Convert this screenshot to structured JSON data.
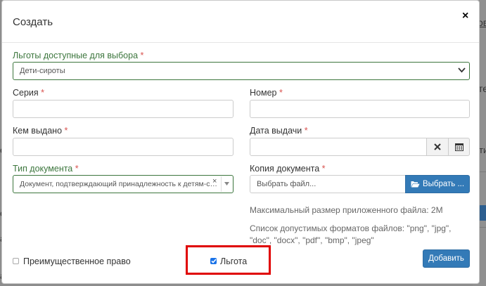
{
  "background": {
    "right_fragments": [
      "ов",
      "те",
      "ти"
    ],
    "left_fragments": [
      "е",
      "е",
      "а",
      "а"
    ]
  },
  "dialog": {
    "title": "Создать",
    "close_symbol": "×"
  },
  "form": {
    "benefits": {
      "label": "Льготы доступные для выбора",
      "required_mark": "*",
      "value": "Дети-сироты"
    },
    "series": {
      "label": "Серия",
      "required_mark": "*",
      "value": ""
    },
    "number": {
      "label": "Номер",
      "required_mark": "*",
      "value": ""
    },
    "issued_by": {
      "label": "Кем выдано",
      "required_mark": "*",
      "value": ""
    },
    "issue_date": {
      "label": "Дата выдачи",
      "required_mark": "*",
      "value": ""
    },
    "doc_type": {
      "label": "Тип документа",
      "required_mark": "*",
      "value": "Документ, подтверждающий принадлежность к детям-с…",
      "clear_symbol": "×"
    },
    "doc_copy": {
      "label": "Копия документа",
      "required_mark": "*",
      "placeholder": "Выбрать файл...",
      "browse_label": "Выбрать ..."
    },
    "max_size_text": "Максимальный размер приложенного файла: 2М",
    "formats_text": "Список допустимых форматов файлов: \"png\", \"jpg\", \"doc\", \"docx\", \"pdf\", \"bmp\", \"jpeg\"",
    "priority_right": {
      "label": "Преимущественное право",
      "checked": false
    },
    "benefit": {
      "label": "Льгота",
      "checked": true
    },
    "submit_label": "Добавить"
  },
  "colors": {
    "primary": "#337ab7",
    "success_label": "#3c763d",
    "required": "#d9534f",
    "highlight": "#e00000"
  }
}
